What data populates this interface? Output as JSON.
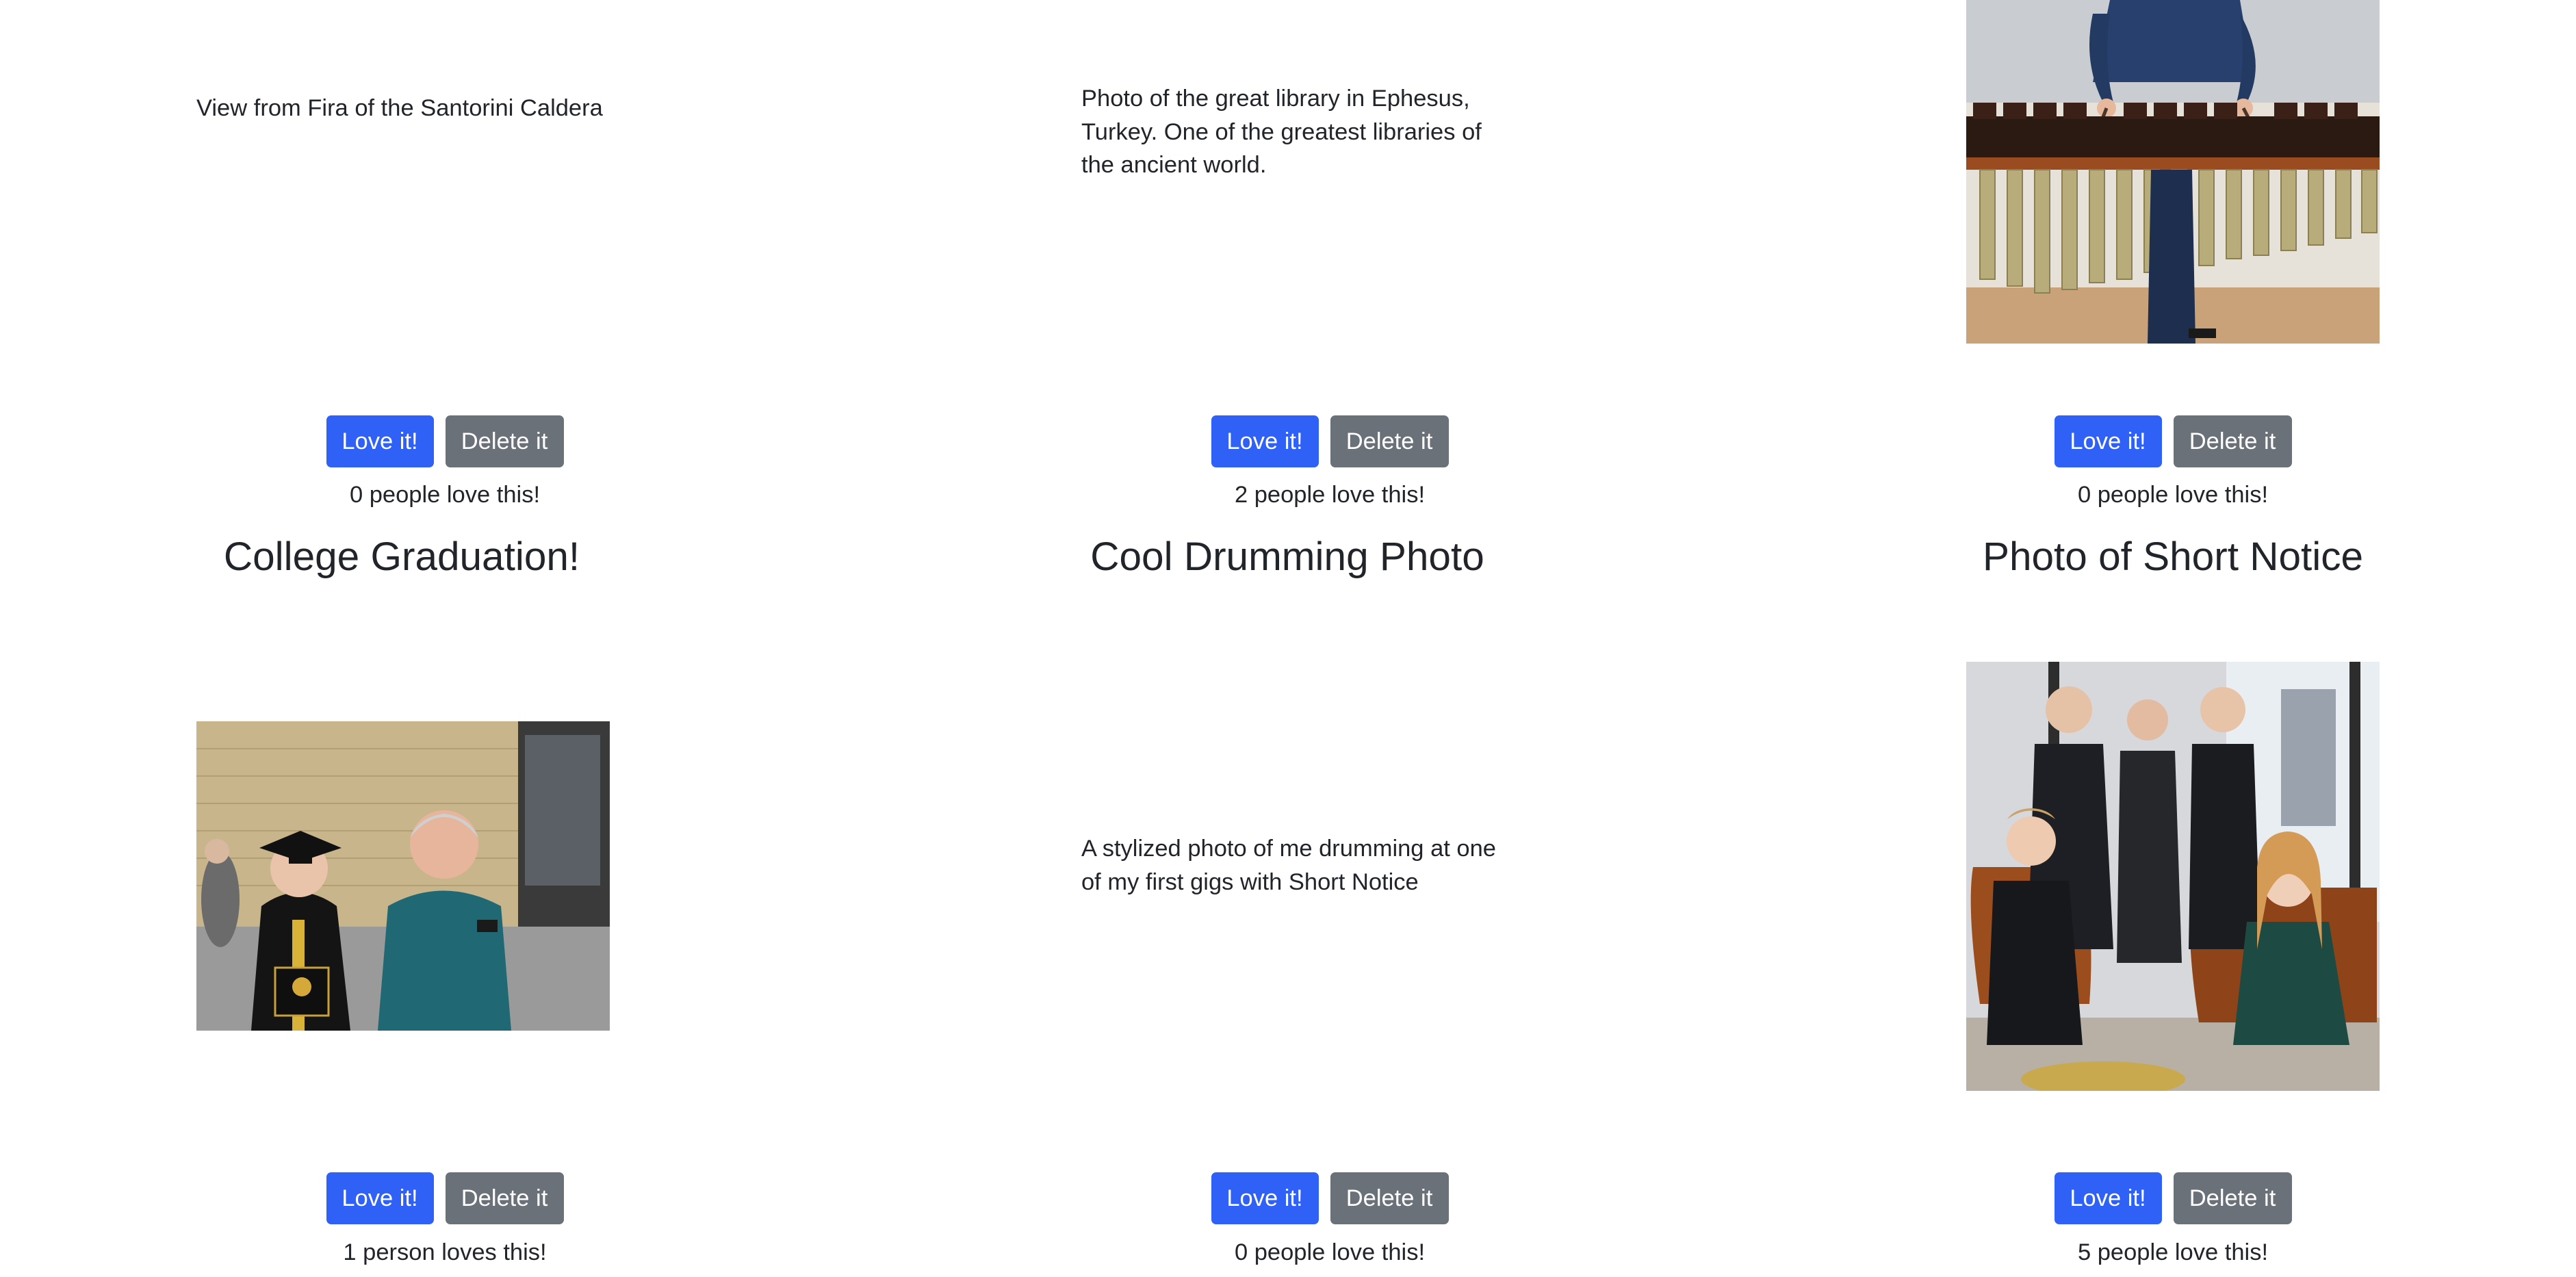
{
  "row1": {
    "santorini": {
      "description": "View from Fira of the Santorini Caldera",
      "love_label": "Love it!",
      "delete_label": "Delete it",
      "love_count": "0 people love this!"
    },
    "ephesus": {
      "description": "Photo of the great library in Ephesus, Turkey. One of the greatest libraries of the ancient world.",
      "love_label": "Love it!",
      "delete_label": "Delete it",
      "love_count": "2 people love this!"
    },
    "marimba": {
      "love_label": "Love it!",
      "delete_label": "Delete it",
      "love_count": "0 people love this!"
    }
  },
  "row2": {
    "graduation": {
      "title": "College Graduation!",
      "love_label": "Love it!",
      "delete_label": "Delete it",
      "love_count": "1 person loves this!"
    },
    "drumming": {
      "title": "Cool Drumming Photo",
      "description": "A stylized photo of me drumming at one of my first gigs with Short Notice",
      "love_label": "Love it!",
      "delete_label": "Delete it",
      "love_count": "0 people love this!"
    },
    "short_notice": {
      "title": "Photo of Short Notice",
      "love_label": "Love it!",
      "delete_label": "Delete it",
      "love_count": "5 people love this!"
    }
  },
  "colors": {
    "love_button": "#2f61f7",
    "delete_button": "#6a7178",
    "text": "#212529"
  }
}
